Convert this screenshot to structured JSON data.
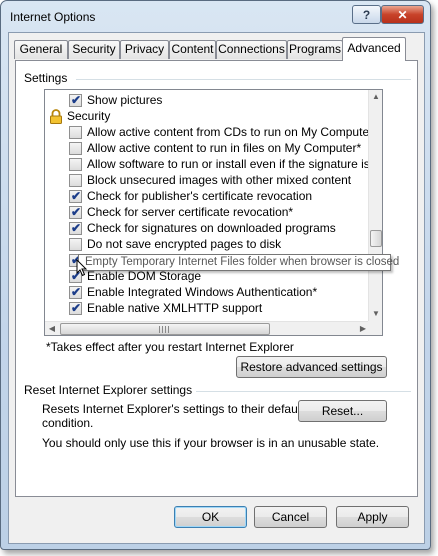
{
  "window": {
    "title": "Internet Options"
  },
  "tabs": [
    "General",
    "Security",
    "Privacy",
    "Content",
    "Connections",
    "Programs",
    "Advanced"
  ],
  "settings": {
    "group_label": "Settings",
    "items": [
      {
        "label": "Show pictures",
        "type": "checkbox",
        "checked": true
      },
      {
        "label": "Security",
        "type": "category",
        "icon": "lock-icon"
      },
      {
        "label": "Allow active content from CDs to run on My Computer*",
        "type": "checkbox",
        "checked": false
      },
      {
        "label": "Allow active content to run in files on My Computer*",
        "type": "checkbox",
        "checked": false
      },
      {
        "label": "Allow software to run or install even if the signature is inva",
        "type": "checkbox",
        "checked": false
      },
      {
        "label": "Block unsecured images with other mixed content",
        "type": "checkbox",
        "checked": false
      },
      {
        "label": "Check for publisher's certificate revocation",
        "type": "checkbox",
        "checked": true
      },
      {
        "label": "Check for server certificate revocation*",
        "type": "checkbox",
        "checked": true
      },
      {
        "label": "Check for signatures on downloaded programs",
        "type": "checkbox",
        "checked": true
      },
      {
        "label": "Do not save encrypted pages to disk",
        "type": "checkbox",
        "checked": false
      },
      {
        "label": "Empty Temporary Internet Files folder when browser is closed",
        "type": "checkbox",
        "checked": true
      },
      {
        "label": "Enable DOM Storage",
        "type": "checkbox",
        "checked": true
      },
      {
        "label": "Enable Integrated Windows Authentication*",
        "type": "checkbox",
        "checked": true
      },
      {
        "label": "Enable native XMLHTTP support",
        "type": "checkbox",
        "checked": true
      }
    ],
    "tooltip": "Empty Temporary Internet Files folder when browser is closed",
    "restart_note": "*Takes effect after you restart Internet Explorer",
    "restore_button": "Restore advanced settings"
  },
  "reset": {
    "group_label": "Reset Internet Explorer settings",
    "description_line1": "Resets Internet Explorer's settings to their default",
    "description_line2": "condition.",
    "reset_button": "Reset...",
    "warning": "You should only use this if your browser is in an unusable state."
  },
  "footer": {
    "ok": "OK",
    "cancel": "Cancel",
    "apply": "Apply"
  },
  "colors": {
    "titlebar": "#c3d5ea",
    "close_button": "#c8432a",
    "check_mark": "#1c3d8a",
    "default_button_border": "#3c7fb1"
  }
}
